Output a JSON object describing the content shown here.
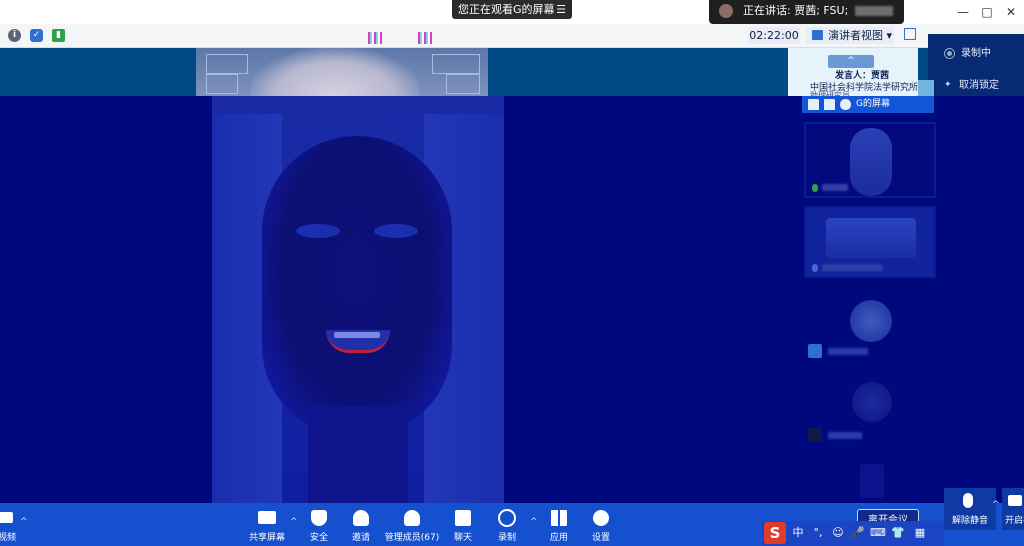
{
  "window": {
    "viewing_banner": "您正在观看G的屏幕",
    "speaking_prefix": "正在讲话:",
    "speaking_names": "贾茜; FSU;",
    "minimize": "—",
    "maximize": "□",
    "close": "✕"
  },
  "toolbar": {
    "timer": "02:22:00",
    "speaker_view_label": "演讲者视图",
    "speaker_view_caret": "▾"
  },
  "recording": {
    "status_label": "录制中",
    "unpin_label": "取消锁定"
  },
  "speaker_card": {
    "up_arrow": "^",
    "presenter_label": "发言人：贾茜",
    "org_text": "中国社会科学院法学研究所",
    "sub_text": "助理研究员"
  },
  "gallery": {
    "header_label": "G的屏幕"
  },
  "bottom_bar": {
    "video_label": "视频",
    "share_screen_label": "共享屏幕",
    "security_label": "安全",
    "invite_label": "邀请",
    "manage_participants_label": "管理成员(67)",
    "chat_label": "聊天",
    "record_label": "录制",
    "apps_label": "应用",
    "settings_label": "设置",
    "end_meeting_label": "离开会议",
    "unmute_all_label": "解除静音",
    "open_video_label": "开启视"
  },
  "ime": {
    "logo": "S",
    "lang": "中",
    "punct": "°,",
    "emoji": "☺",
    "voice": "🎤",
    "keyboard": "⌨",
    "skin": "👕",
    "tools": "▦"
  },
  "colors": {
    "stage_bg": "#00087e",
    "bottom_bar": "#1551cf",
    "accent": "#1255d9",
    "mouth_red": "#c0203a",
    "ime_red": "#e23b2a"
  }
}
